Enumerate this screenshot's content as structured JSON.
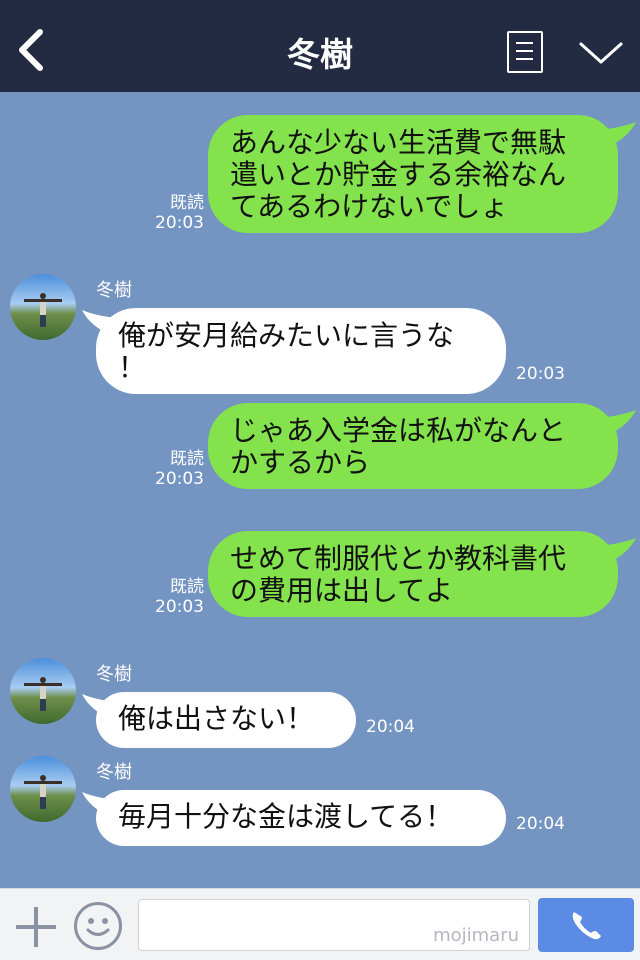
{
  "header": {
    "title": "冬樹"
  },
  "messages": [
    {
      "side": "me",
      "lines": [
        "あんな少ない生活費で無駄",
        "遣いとか貯金する余裕なん",
        "てあるわけないでしょ"
      ],
      "read": "既読",
      "time": "20:03"
    },
    {
      "side": "other",
      "sender": "冬樹",
      "lines": [
        "俺が安月給みたいに言うな",
        "！"
      ],
      "time": "20:03"
    },
    {
      "side": "me",
      "lines": [
        "じゃあ入学金は私がなんと",
        "かするから"
      ],
      "read": "既読",
      "time": "20:03"
    },
    {
      "side": "me",
      "lines": [
        "せめて制服代とか教科書代",
        "の費用は出してよ"
      ],
      "read": "既読",
      "time": "20:03"
    },
    {
      "side": "other",
      "sender": "冬樹",
      "lines": [
        "俺は出さない！"
      ],
      "time": "20:04"
    },
    {
      "side": "other",
      "sender": "冬樹",
      "lines": [
        "毎月十分な金は渡してる！"
      ],
      "time": "20:04"
    }
  ],
  "input": {
    "watermark": "mojimaru"
  },
  "icons": {
    "back": "chevron-left-icon",
    "notes": "notes-icon",
    "menu": "chevron-down-icon",
    "plus": "plus-icon",
    "emoji": "smiley-icon",
    "call": "phone-icon"
  },
  "colors": {
    "header_bg": "#222b41",
    "chat_bg": "#7494c1",
    "my_bubble": "#84e24c",
    "other_bubble": "#ffffff",
    "call_button": "#5b8be4"
  }
}
